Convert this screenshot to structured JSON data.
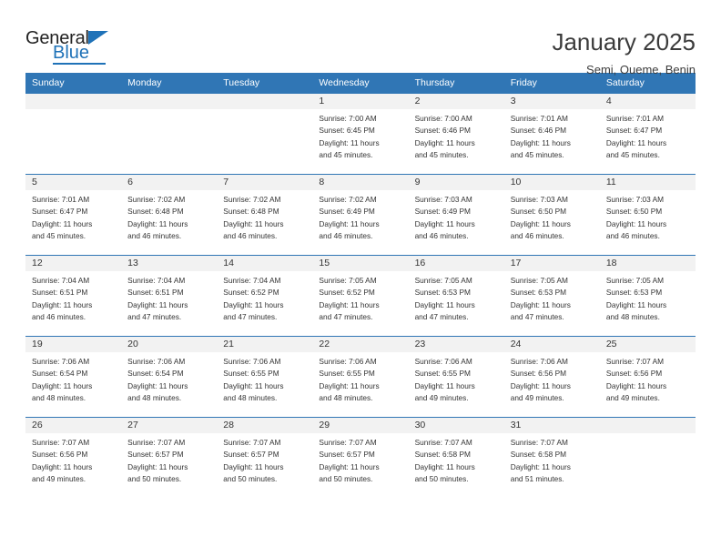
{
  "brand": {
    "name_top": "General",
    "name_bottom": "Blue",
    "accent_color": "#1f72b8"
  },
  "header": {
    "title": "January 2025",
    "subtitle": "Semi, Oueme, Benin"
  },
  "theme": {
    "header_blue": "#3076b5",
    "daynum_band": "#f2f2f2",
    "text": "#333333"
  },
  "weekdays": [
    "Sunday",
    "Monday",
    "Tuesday",
    "Wednesday",
    "Thursday",
    "Friday",
    "Saturday"
  ],
  "labels": {
    "sunrise": "Sunrise:",
    "sunset": "Sunset:",
    "daylight": "Daylight:"
  },
  "weeks": [
    [
      {
        "day": "",
        "empty": true
      },
      {
        "day": "",
        "empty": true
      },
      {
        "day": "",
        "empty": true
      },
      {
        "day": "1",
        "sunrise": "Sunrise: 7:00 AM",
        "sunset": "Sunset: 6:45 PM",
        "daylight1": "Daylight: 11 hours",
        "daylight2": "and 45 minutes."
      },
      {
        "day": "2",
        "sunrise": "Sunrise: 7:00 AM",
        "sunset": "Sunset: 6:46 PM",
        "daylight1": "Daylight: 11 hours",
        "daylight2": "and 45 minutes."
      },
      {
        "day": "3",
        "sunrise": "Sunrise: 7:01 AM",
        "sunset": "Sunset: 6:46 PM",
        "daylight1": "Daylight: 11 hours",
        "daylight2": "and 45 minutes."
      },
      {
        "day": "4",
        "sunrise": "Sunrise: 7:01 AM",
        "sunset": "Sunset: 6:47 PM",
        "daylight1": "Daylight: 11 hours",
        "daylight2": "and 45 minutes."
      }
    ],
    [
      {
        "day": "5",
        "sunrise": "Sunrise: 7:01 AM",
        "sunset": "Sunset: 6:47 PM",
        "daylight1": "Daylight: 11 hours",
        "daylight2": "and 45 minutes."
      },
      {
        "day": "6",
        "sunrise": "Sunrise: 7:02 AM",
        "sunset": "Sunset: 6:48 PM",
        "daylight1": "Daylight: 11 hours",
        "daylight2": "and 46 minutes."
      },
      {
        "day": "7",
        "sunrise": "Sunrise: 7:02 AM",
        "sunset": "Sunset: 6:48 PM",
        "daylight1": "Daylight: 11 hours",
        "daylight2": "and 46 minutes."
      },
      {
        "day": "8",
        "sunrise": "Sunrise: 7:02 AM",
        "sunset": "Sunset: 6:49 PM",
        "daylight1": "Daylight: 11 hours",
        "daylight2": "and 46 minutes."
      },
      {
        "day": "9",
        "sunrise": "Sunrise: 7:03 AM",
        "sunset": "Sunset: 6:49 PM",
        "daylight1": "Daylight: 11 hours",
        "daylight2": "and 46 minutes."
      },
      {
        "day": "10",
        "sunrise": "Sunrise: 7:03 AM",
        "sunset": "Sunset: 6:50 PM",
        "daylight1": "Daylight: 11 hours",
        "daylight2": "and 46 minutes."
      },
      {
        "day": "11",
        "sunrise": "Sunrise: 7:03 AM",
        "sunset": "Sunset: 6:50 PM",
        "daylight1": "Daylight: 11 hours",
        "daylight2": "and 46 minutes."
      }
    ],
    [
      {
        "day": "12",
        "sunrise": "Sunrise: 7:04 AM",
        "sunset": "Sunset: 6:51 PM",
        "daylight1": "Daylight: 11 hours",
        "daylight2": "and 46 minutes."
      },
      {
        "day": "13",
        "sunrise": "Sunrise: 7:04 AM",
        "sunset": "Sunset: 6:51 PM",
        "daylight1": "Daylight: 11 hours",
        "daylight2": "and 47 minutes."
      },
      {
        "day": "14",
        "sunrise": "Sunrise: 7:04 AM",
        "sunset": "Sunset: 6:52 PM",
        "daylight1": "Daylight: 11 hours",
        "daylight2": "and 47 minutes."
      },
      {
        "day": "15",
        "sunrise": "Sunrise: 7:05 AM",
        "sunset": "Sunset: 6:52 PM",
        "daylight1": "Daylight: 11 hours",
        "daylight2": "and 47 minutes."
      },
      {
        "day": "16",
        "sunrise": "Sunrise: 7:05 AM",
        "sunset": "Sunset: 6:53 PM",
        "daylight1": "Daylight: 11 hours",
        "daylight2": "and 47 minutes."
      },
      {
        "day": "17",
        "sunrise": "Sunrise: 7:05 AM",
        "sunset": "Sunset: 6:53 PM",
        "daylight1": "Daylight: 11 hours",
        "daylight2": "and 47 minutes."
      },
      {
        "day": "18",
        "sunrise": "Sunrise: 7:05 AM",
        "sunset": "Sunset: 6:53 PM",
        "daylight1": "Daylight: 11 hours",
        "daylight2": "and 48 minutes."
      }
    ],
    [
      {
        "day": "19",
        "sunrise": "Sunrise: 7:06 AM",
        "sunset": "Sunset: 6:54 PM",
        "daylight1": "Daylight: 11 hours",
        "daylight2": "and 48 minutes."
      },
      {
        "day": "20",
        "sunrise": "Sunrise: 7:06 AM",
        "sunset": "Sunset: 6:54 PM",
        "daylight1": "Daylight: 11 hours",
        "daylight2": "and 48 minutes."
      },
      {
        "day": "21",
        "sunrise": "Sunrise: 7:06 AM",
        "sunset": "Sunset: 6:55 PM",
        "daylight1": "Daylight: 11 hours",
        "daylight2": "and 48 minutes."
      },
      {
        "day": "22",
        "sunrise": "Sunrise: 7:06 AM",
        "sunset": "Sunset: 6:55 PM",
        "daylight1": "Daylight: 11 hours",
        "daylight2": "and 48 minutes."
      },
      {
        "day": "23",
        "sunrise": "Sunrise: 7:06 AM",
        "sunset": "Sunset: 6:55 PM",
        "daylight1": "Daylight: 11 hours",
        "daylight2": "and 49 minutes."
      },
      {
        "day": "24",
        "sunrise": "Sunrise: 7:06 AM",
        "sunset": "Sunset: 6:56 PM",
        "daylight1": "Daylight: 11 hours",
        "daylight2": "and 49 minutes."
      },
      {
        "day": "25",
        "sunrise": "Sunrise: 7:07 AM",
        "sunset": "Sunset: 6:56 PM",
        "daylight1": "Daylight: 11 hours",
        "daylight2": "and 49 minutes."
      }
    ],
    [
      {
        "day": "26",
        "sunrise": "Sunrise: 7:07 AM",
        "sunset": "Sunset: 6:56 PM",
        "daylight1": "Daylight: 11 hours",
        "daylight2": "and 49 minutes."
      },
      {
        "day": "27",
        "sunrise": "Sunrise: 7:07 AM",
        "sunset": "Sunset: 6:57 PM",
        "daylight1": "Daylight: 11 hours",
        "daylight2": "and 50 minutes."
      },
      {
        "day": "28",
        "sunrise": "Sunrise: 7:07 AM",
        "sunset": "Sunset: 6:57 PM",
        "daylight1": "Daylight: 11 hours",
        "daylight2": "and 50 minutes."
      },
      {
        "day": "29",
        "sunrise": "Sunrise: 7:07 AM",
        "sunset": "Sunset: 6:57 PM",
        "daylight1": "Daylight: 11 hours",
        "daylight2": "and 50 minutes."
      },
      {
        "day": "30",
        "sunrise": "Sunrise: 7:07 AM",
        "sunset": "Sunset: 6:58 PM",
        "daylight1": "Daylight: 11 hours",
        "daylight2": "and 50 minutes."
      },
      {
        "day": "31",
        "sunrise": "Sunrise: 7:07 AM",
        "sunset": "Sunset: 6:58 PM",
        "daylight1": "Daylight: 11 hours",
        "daylight2": "and 51 minutes."
      },
      {
        "day": "",
        "empty": true
      }
    ]
  ]
}
